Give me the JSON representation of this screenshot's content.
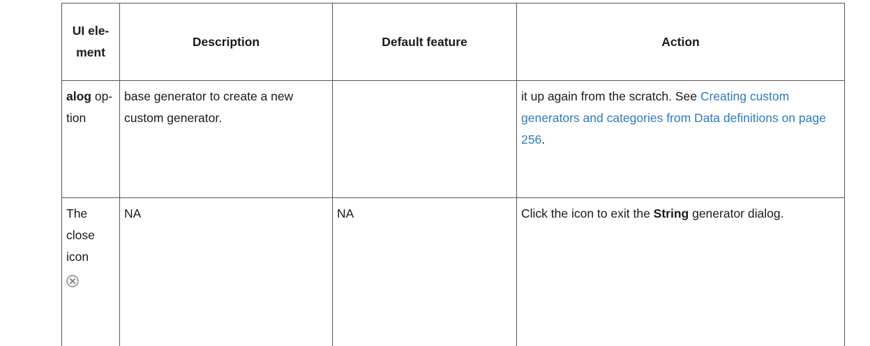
{
  "table": {
    "headers": {
      "ui_element": "UI ele- ment",
      "description": "Description",
      "default_feature": "Default feature",
      "action": "Action"
    },
    "row_continued": {
      "ui_element_bold": "alog",
      "ui_element_rest": "op- tion",
      "description": "base generator to create a new custom generator.",
      "default_feature": "",
      "action_text": "it up again from the scratch. See ",
      "action_link": "Creating custom generators and categories from Data definitions on page 256",
      "action_after": "."
    },
    "row_close": {
      "ui_element": "The close icon",
      "icon": "close-circle-icon",
      "description": "NA",
      "default_feature": "NA",
      "action_before": "Click the icon to exit the ",
      "action_bold": "String",
      "action_after": " generator dialog."
    }
  },
  "colors": {
    "link": "#2e7abf",
    "border": "#555555",
    "icon": "#8a8a8a"
  }
}
